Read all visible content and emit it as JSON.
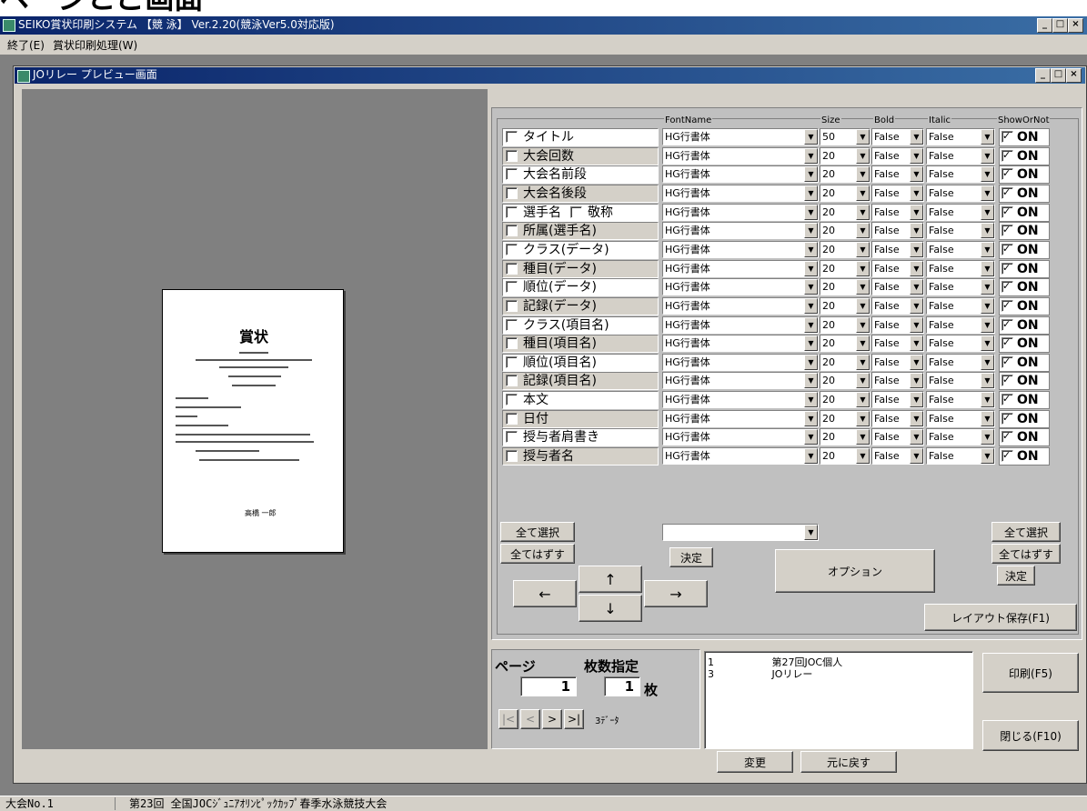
{
  "heading": "ページとご画面",
  "app": {
    "title": "SEIKO賞状印刷システム 【競 泳】 Ver.2.20(競泳Ver5.0対応版)"
  },
  "menu": {
    "items": [
      "終了(E)",
      "賞状印刷処理(W)"
    ]
  },
  "child": {
    "title": "JOリレー プレビュー画面"
  },
  "preview": {
    "heading": "賞状",
    "signature": "高橋 一郎"
  },
  "columns": {
    "font": "FontName",
    "size": "Size",
    "bold": "Bold",
    "italic": "Italic",
    "show": "ShowOrNot"
  },
  "rows": [
    {
      "label": "タイトル",
      "font": "HG行書体",
      "size": "50",
      "bold": "False",
      "italic": "False",
      "show": "ON",
      "style": "white"
    },
    {
      "label": "大会回数",
      "font": "HG行書体",
      "size": "20",
      "bold": "False",
      "italic": "False",
      "show": "ON",
      "style": "gray"
    },
    {
      "label": "大会名前段",
      "font": "HG行書体",
      "size": "20",
      "bold": "False",
      "italic": "False",
      "show": "ON",
      "style": "white"
    },
    {
      "label": "大会名後段",
      "font": "HG行書体",
      "size": "20",
      "bold": "False",
      "italic": "False",
      "show": "ON",
      "style": "gray"
    },
    {
      "label": "選手名",
      "font": "HG行書体",
      "size": "20",
      "bold": "False",
      "italic": "False",
      "show": "ON",
      "style": "white",
      "extra": "敬称"
    },
    {
      "label": "所属(選手名)",
      "font": "HG行書体",
      "size": "20",
      "bold": "False",
      "italic": "False",
      "show": "ON",
      "style": "gray"
    },
    {
      "label": "クラス(データ)",
      "font": "HG行書体",
      "size": "20",
      "bold": "False",
      "italic": "False",
      "show": "ON",
      "style": "white"
    },
    {
      "label": "種目(データ)",
      "font": "HG行書体",
      "size": "20",
      "bold": "False",
      "italic": "False",
      "show": "ON",
      "style": "gray"
    },
    {
      "label": "順位(データ)",
      "font": "HG行書体",
      "size": "20",
      "bold": "False",
      "italic": "False",
      "show": "ON",
      "style": "white"
    },
    {
      "label": "記録(データ)",
      "font": "HG行書体",
      "size": "20",
      "bold": "False",
      "italic": "False",
      "show": "ON",
      "style": "gray"
    },
    {
      "label": "クラス(項目名)",
      "font": "HG行書体",
      "size": "20",
      "bold": "False",
      "italic": "False",
      "show": "ON",
      "style": "white"
    },
    {
      "label": "種目(項目名)",
      "font": "HG行書体",
      "size": "20",
      "bold": "False",
      "italic": "False",
      "show": "ON",
      "style": "gray"
    },
    {
      "label": "順位(項目名)",
      "font": "HG行書体",
      "size": "20",
      "bold": "False",
      "italic": "False",
      "show": "ON",
      "style": "white"
    },
    {
      "label": "記録(項目名)",
      "font": "HG行書体",
      "size": "20",
      "bold": "False",
      "italic": "False",
      "show": "ON",
      "style": "gray"
    },
    {
      "label": "本文",
      "font": "HG行書体",
      "size": "20",
      "bold": "False",
      "italic": "False",
      "show": "ON",
      "style": "white"
    },
    {
      "label": "日付",
      "font": "HG行書体",
      "size": "20",
      "bold": "False",
      "italic": "False",
      "show": "ON",
      "style": "gray"
    },
    {
      "label": "授与者肩書き",
      "font": "HG行書体",
      "size": "20",
      "bold": "False",
      "italic": "False",
      "show": "ON",
      "style": "white"
    },
    {
      "label": "授与者名",
      "font": "HG行書体",
      "size": "20",
      "bold": "False",
      "italic": "False",
      "show": "ON",
      "style": "gray"
    }
  ],
  "controls": {
    "select_all": "全て選択",
    "deselect_all": "全てはずす",
    "decide": "決定",
    "option": "オプション",
    "layout_save": "レイアウト保存(F1)",
    "up": "↑",
    "down": "↓",
    "left": "←",
    "right": "→"
  },
  "paging": {
    "page_label": "ページ",
    "count_label": "枚数指定",
    "page_value": "1",
    "count_value": "1",
    "count_unit": "枚",
    "nav": [
      "|<",
      "<",
      ">",
      ">|"
    ],
    "data_count": "3ﾃﾞｰﾀ"
  },
  "list": {
    "items": [
      {
        "no": "1",
        "name": "第27回JOC個人"
      },
      {
        "no": "3",
        "name": "JOリレー"
      }
    ]
  },
  "buttons": {
    "print": "印刷(F5)",
    "close": "閉じる(F10)",
    "change": "変更",
    "undo": "元に戻す"
  },
  "status": {
    "segments": [
      "大会No.1",
      "第23回 全国JOCｼﾞｭﾆｱｵﾘﾝﾋﾟｯｸｶｯﾌﾟ春季水泳競技大会"
    ]
  }
}
